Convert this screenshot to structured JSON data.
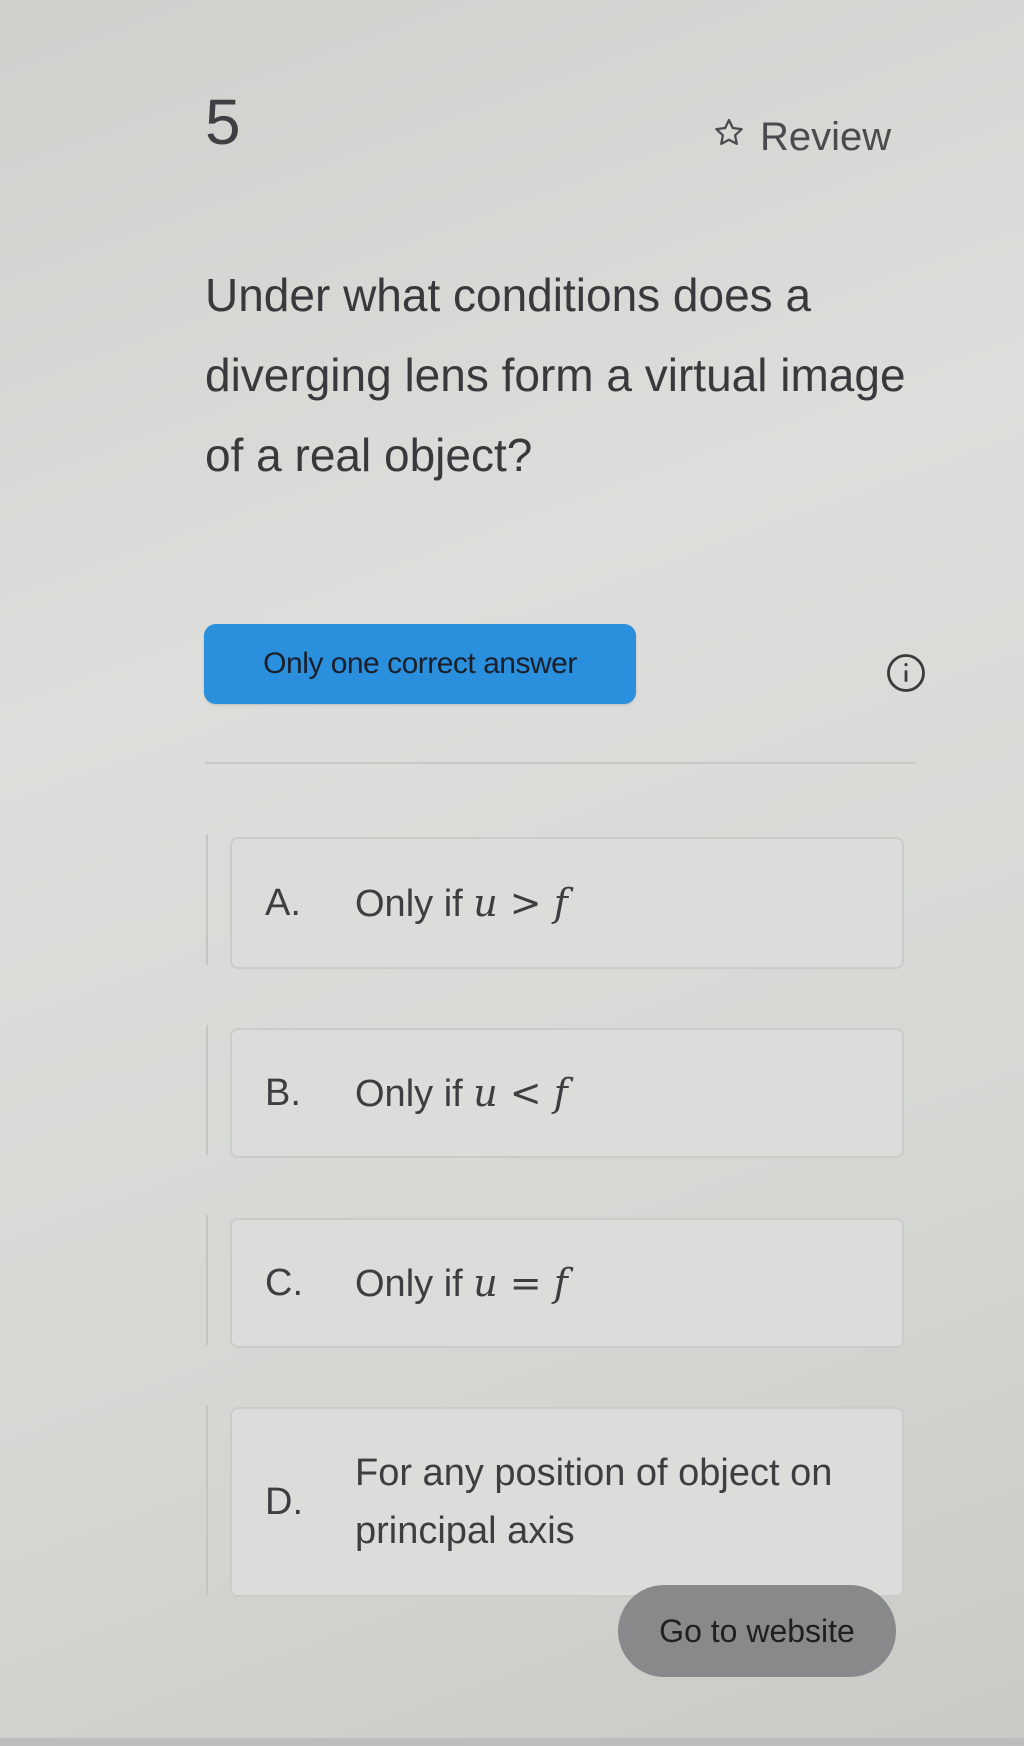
{
  "question": {
    "number": "5",
    "review_label": "Review",
    "text": "Under what conditions does a diverging lens form a virtual image of a real object?"
  },
  "answer_type_badge": "Only one correct answer",
  "options": [
    {
      "letter": "A.",
      "prefix": "Only if ",
      "math": "u > f",
      "text": ""
    },
    {
      "letter": "B.",
      "prefix": "Only if ",
      "math": "u < f",
      "text": ""
    },
    {
      "letter": "C.",
      "prefix": "Only if ",
      "math": "u = f",
      "text": ""
    },
    {
      "letter": "D.",
      "prefix": "",
      "math": "",
      "text": "For any position of object on principal axis"
    }
  ],
  "go_to_website_label": "Go to website",
  "icons": {
    "review": "star-outline-icon",
    "info": "info-circle-icon"
  },
  "colors": {
    "badge_blue": "#2a8fdc",
    "button_gray": "#88898a"
  }
}
